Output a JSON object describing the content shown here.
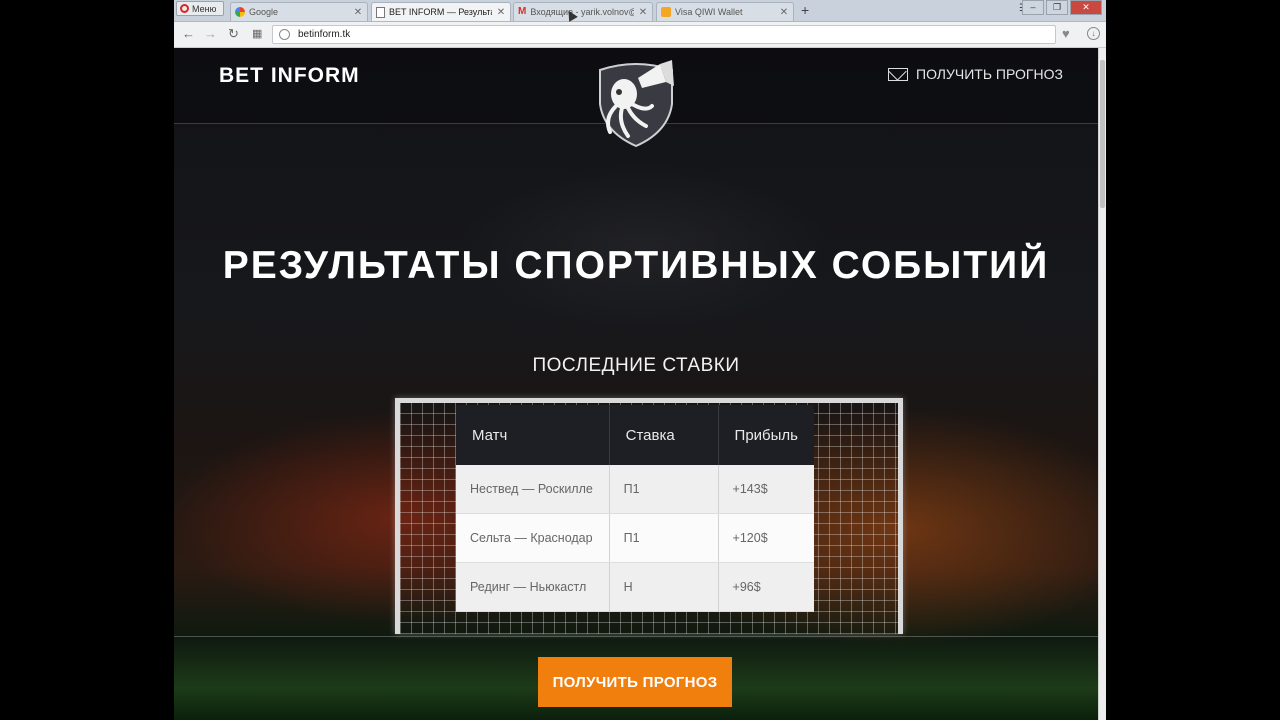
{
  "browser": {
    "menu_label": "Меню",
    "tabs": [
      {
        "label": "Google",
        "icon": "google-icon",
        "active": false
      },
      {
        "label": "BET INFORM — Результат",
        "icon": "page-icon",
        "active": true
      },
      {
        "label": "Входящие - yarik.volnov@",
        "icon": "gmail-icon",
        "active": false
      },
      {
        "label": "Visa QIWI Wallet",
        "icon": "qiwi-icon",
        "active": false
      }
    ],
    "address": "betinform.tk"
  },
  "site": {
    "logo": "BET INFORM",
    "header_cta": "ПОЛУЧИТЬ ПРОГНОЗ",
    "hero_title": "РЕЗУЛЬТАТЫ СПОРТИВНЫХ СОБЫТИЙ",
    "subtitle": "ПОСЛЕДНИЕ СТАВКИ",
    "table": {
      "headers": [
        "Матч",
        "Ставка",
        "Прибыль"
      ],
      "rows": [
        [
          "Нествед — Роскилле",
          "П1",
          "+143$"
        ],
        [
          "Сельта — Краснодар",
          "П1",
          "+120$"
        ],
        [
          "Рединг — Ньюкастл",
          "Н",
          "+96$"
        ]
      ]
    },
    "cta_button": "ПОЛУЧИТЬ ПРОГНОЗ"
  },
  "colors": {
    "accent": "#f07f0e",
    "header_bg": "#1e1f24"
  }
}
